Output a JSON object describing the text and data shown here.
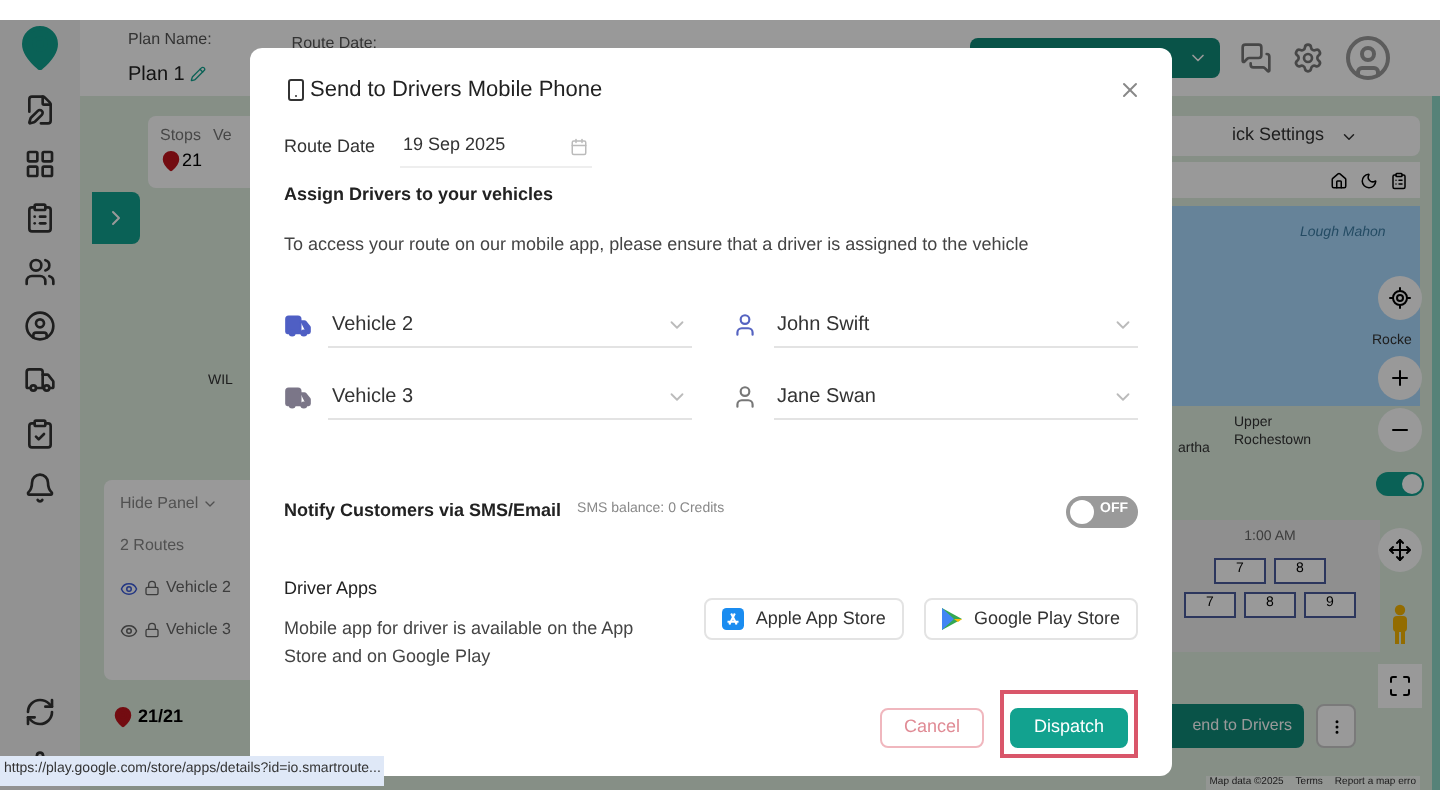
{
  "header": {
    "plan_label": "Plan Name:",
    "plan_name": "Plan 1",
    "date_label": "Route Date:"
  },
  "map": {
    "stops_label": "Stops",
    "stops_count": "21",
    "vehicles_label": "Ve",
    "quick_settings": "ick Settings",
    "labels": [
      {
        "text": "Lough Mahon"
      },
      {
        "text": "Rocke"
      },
      {
        "text": "Upper Rochestown"
      },
      {
        "text": "artha"
      },
      {
        "text": "WIL"
      }
    ],
    "panel": {
      "toggle": "Hide Panel",
      "count": "2 Routes",
      "routes": [
        {
          "name": "Vehicle 2",
          "selected": true
        },
        {
          "name": "Vehicle 3",
          "selected": false
        }
      ]
    },
    "stops_done": "21/21",
    "timeline": {
      "time": "1:00 AM",
      "rows": [
        [
          "7",
          "8"
        ],
        [
          "7",
          "8",
          "9"
        ]
      ]
    },
    "send_button": "end to Drivers",
    "layer_switch": {
      "on": true
    },
    "attribution": [
      "Map data ©2025",
      "Terms",
      "Report a map erro"
    ]
  },
  "dialog": {
    "title": "Send to Drivers Mobile Phone",
    "route_date": {
      "label": "Route Date",
      "value": "19 Sep 2025"
    },
    "assign_heading": "Assign Drivers to your vehicles",
    "assign_note": "To access your route on our mobile app, please ensure that a driver is assigned to the vehicle",
    "assignments": [
      {
        "vehicle": "Vehicle 2",
        "driver": "John Swift",
        "color": "#4f5fc4"
      },
      {
        "vehicle": "Vehicle 3",
        "driver": "Jane Swan",
        "color": "#7b7688"
      }
    ],
    "notify": {
      "label": "Notify Customers via SMS/Email",
      "balance": "SMS balance: 0 Credits",
      "on": false,
      "state_text": "OFF"
    },
    "apps": {
      "heading": "Driver Apps",
      "note": "Mobile app for driver is available on the App Store and on Google Play",
      "stores": [
        {
          "kind": "apple",
          "label": "Apple App Store"
        },
        {
          "kind": "google",
          "label": "Google Play Store"
        }
      ]
    },
    "actions": [
      {
        "kind": "cancel",
        "label": "Cancel",
        "highlighted": false
      },
      {
        "kind": "primary",
        "label": "Dispatch",
        "highlighted": true
      }
    ]
  },
  "status_url": "https://play.google.com/store/apps/details?id=io.smartroute..."
}
